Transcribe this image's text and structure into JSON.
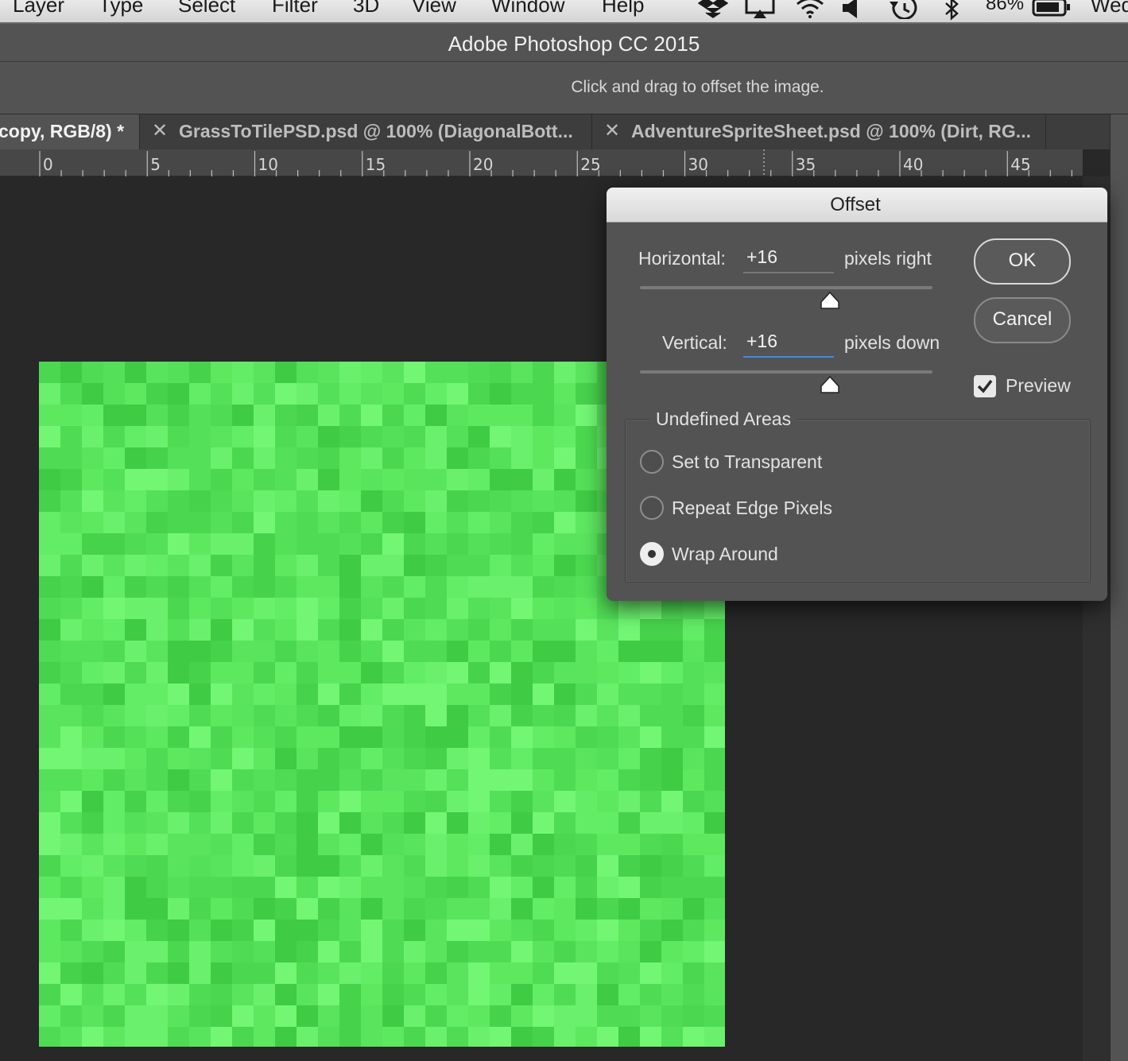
{
  "menubar": {
    "items": [
      "Layer",
      "Type",
      "Select",
      "Filter",
      "3D",
      "View",
      "Window",
      "Help"
    ],
    "battery_percent": "86%",
    "clock_fragment": "Wed",
    "tray_icons": [
      "dropbox-icon",
      "airplay-icon",
      "wifi-icon",
      "volume-icon",
      "time-machine-icon",
      "bluetooth-icon",
      "battery-icon"
    ]
  },
  "app": {
    "title": "Adobe Photoshop CC 2015"
  },
  "options_bar": {
    "hint": "Click and drag to offset the image."
  },
  "tabs": [
    {
      "label": "copy, RGB/8) *",
      "active": true
    },
    {
      "label": "GrassToTilePSD.psd @ 100% (DiagonalBott...",
      "active": false
    },
    {
      "label": "AdventureSpriteSheet.psd @ 100% (Dirt, RG...",
      "active": false
    }
  ],
  "ruler": {
    "labels": [
      "0",
      "5",
      "10",
      "15",
      "20",
      "25",
      "30",
      "35",
      "40",
      "45"
    ]
  },
  "image": {
    "base_color": "#58e65c",
    "tile_colors": [
      "#4fdc54",
      "#5ae45e",
      "#63ec66",
      "#54e058",
      "#6af06c",
      "#47d24c",
      "#5ee860",
      "#72f674",
      "#4bd850",
      "#3fcb44"
    ]
  },
  "dialog": {
    "title": "Offset",
    "horizontal": {
      "label": "Horizontal:",
      "value": "+16",
      "unit": "pixels right",
      "slider_fraction": 0.65
    },
    "vertical": {
      "label": "Vertical:",
      "value": "+16",
      "unit": "pixels down",
      "slider_fraction": 0.65
    },
    "ok_label": "OK",
    "cancel_label": "Cancel",
    "preview_label": "Preview",
    "preview_checked": true,
    "undefined_areas": {
      "legend": "Undefined Areas",
      "options": [
        {
          "label": "Set to Transparent",
          "selected": false
        },
        {
          "label": "Repeat Edge Pixels",
          "selected": false
        },
        {
          "label": "Wrap Around",
          "selected": true
        }
      ]
    }
  },
  "colors": {
    "focus_blue": "#3f8be6",
    "panel_gray": "#535353",
    "canvas_dark": "#282828"
  }
}
